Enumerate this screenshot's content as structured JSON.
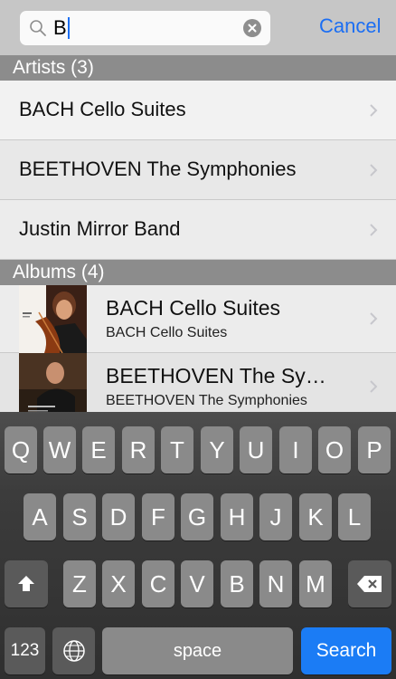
{
  "search": {
    "query": "B",
    "cancel_label": "Cancel"
  },
  "artists": {
    "header": "Artists (3)",
    "items": [
      {
        "label": "BACH Cello Suites"
      },
      {
        "label": "BEETHOVEN  The Symphonies"
      },
      {
        "label": "Justin Mirror Band"
      }
    ]
  },
  "albums": {
    "header": "Albums (4)",
    "items": [
      {
        "title": "BACH Cello Suites",
        "subtitle": "BACH Cello Suites"
      },
      {
        "title": "BEETHOVEN  The Sy…",
        "subtitle": "BEETHOVEN  The Symphonies"
      }
    ]
  },
  "keyboard": {
    "row1": [
      "Q",
      "W",
      "E",
      "R",
      "T",
      "Y",
      "U",
      "I",
      "O",
      "P"
    ],
    "row2": [
      "A",
      "S",
      "D",
      "F",
      "G",
      "H",
      "J",
      "K",
      "L"
    ],
    "row3": [
      "Z",
      "X",
      "C",
      "V",
      "B",
      "N",
      "M"
    ],
    "numbers_label": "123",
    "space_label": "space",
    "search_label": "Search"
  },
  "colors": {
    "accent": "#1b6ef3",
    "search_key": "#1b7cf5",
    "section_header": "#8c8c8c"
  },
  "icons": [
    "magnifier-icon",
    "clear-icon",
    "chevron-right-icon",
    "shift-icon",
    "globe-icon",
    "delete-icon"
  ]
}
